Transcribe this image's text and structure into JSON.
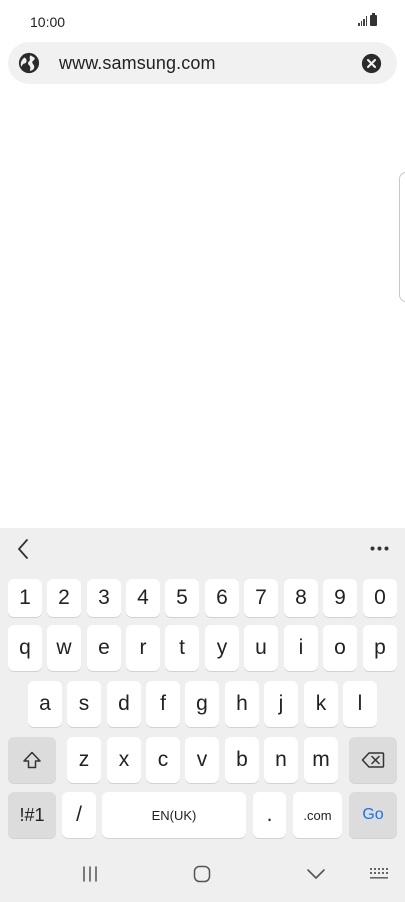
{
  "status_bar": {
    "time": "10:00"
  },
  "url_bar": {
    "url": "www.samsung.com"
  },
  "keyboard": {
    "number_row": [
      "1",
      "2",
      "3",
      "4",
      "5",
      "6",
      "7",
      "8",
      "9",
      "0"
    ],
    "row1": [
      "q",
      "w",
      "e",
      "r",
      "t",
      "y",
      "u",
      "i",
      "o",
      "p"
    ],
    "row2": [
      "a",
      "s",
      "d",
      "f",
      "g",
      "h",
      "j",
      "k",
      "l"
    ],
    "row3": [
      "z",
      "x",
      "c",
      "v",
      "b",
      "n",
      "m"
    ],
    "symbols_label": "!#1",
    "slash_label": "/",
    "space_label": "EN(UK)",
    "period_label": ".",
    "dotcom_label": ".com",
    "go_label": "Go",
    "go_color": "#1a73e8"
  }
}
